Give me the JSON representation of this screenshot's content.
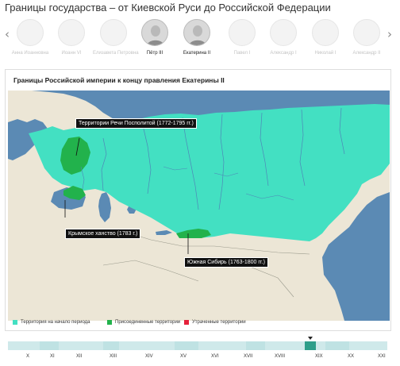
{
  "page": {
    "title": "Границы государства – от Киевской Руси до Российской Федерации"
  },
  "rulers_nav": {
    "prev_icon": "chevron-left-icon",
    "next_icon": "chevron-right-icon",
    "items": [
      {
        "name": "Анна Иоанновна",
        "active": false
      },
      {
        "name": "Иоанн VI",
        "active": false
      },
      {
        "name": "Елизавета Петровна",
        "active": false
      },
      {
        "name": "Пётр III",
        "active": true
      },
      {
        "name": "Екатерина II",
        "active": true
      },
      {
        "name": "Павел I",
        "active": false
      },
      {
        "name": "Александр I",
        "active": false
      },
      {
        "name": "Николай I",
        "active": false
      },
      {
        "name": "Александр II",
        "active": false
      }
    ]
  },
  "map": {
    "title": "Границы Российской империи к концу правления Екатерины II",
    "labels": {
      "rzeczpospolita": "Территории Речи Посполитой (1772-1795 гг.)",
      "crimea": "Крымское ханство (1783 г.)",
      "south_siberia": "Южная Сибирь (1763-1800 гг.)"
    },
    "colors": {
      "sea": "#5b8ab4",
      "land": "#ece6d6",
      "territory": "#43e0c2",
      "annexed": "#22b24c",
      "lost": "#e5213b"
    }
  },
  "legend": [
    {
      "label": "Территория на начало периода",
      "color": "#43e0c2"
    },
    {
      "label": "Присоединенные территории",
      "color": "#22b24c"
    },
    {
      "label": "Утраченные территории",
      "color": "#e5213b"
    }
  ],
  "timeline": {
    "centuries": [
      "X",
      "XI",
      "XII",
      "XIII",
      "XIV",
      "XV",
      "XVI",
      "XVII",
      "XVIII",
      "XIX",
      "XX",
      "XXI"
    ],
    "track_color": "#cfe9ea",
    "selected_color": "#2e9e8a"
  }
}
